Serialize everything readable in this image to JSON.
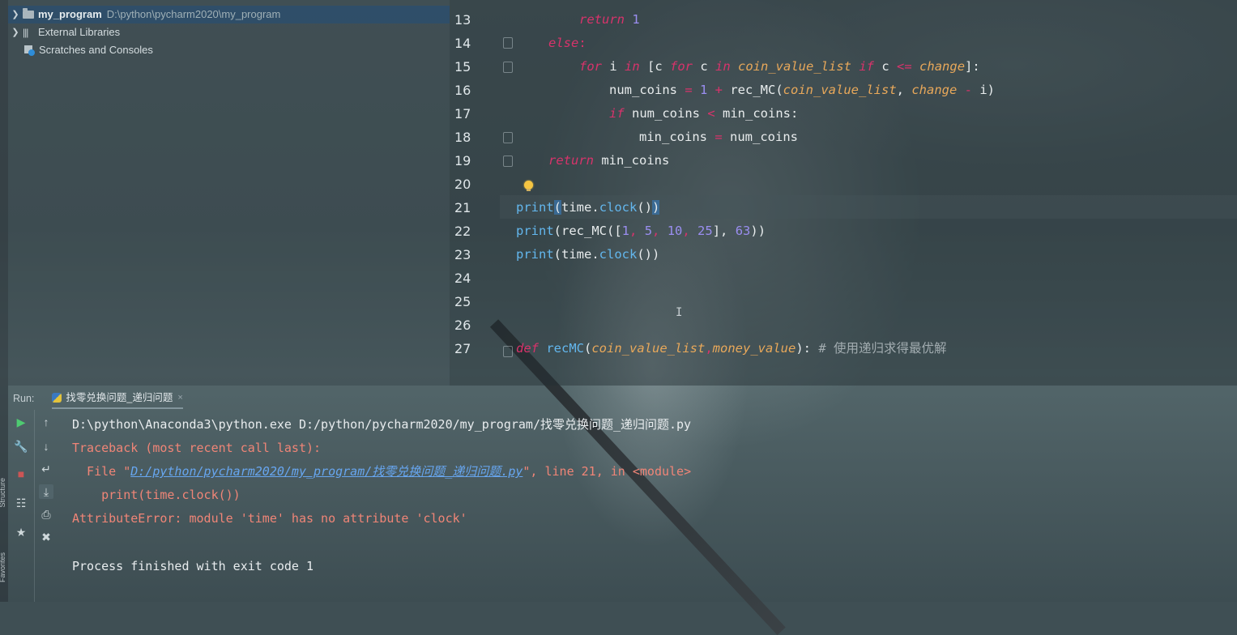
{
  "strip": {
    "structure_label": "Structure",
    "favorites_label": "Favorites"
  },
  "project_tree": [
    {
      "name": "my_program",
      "path": "D:\\python\\pycharm2020\\my_program",
      "selected": true
    },
    {
      "name": "External Libraries",
      "path": "",
      "selected": false
    },
    {
      "name": "Scratches and Consoles",
      "path": "",
      "selected": false
    }
  ],
  "editor": {
    "line_numbers": [
      "13",
      "14",
      "15",
      "16",
      "17",
      "18",
      "19",
      "20",
      "21",
      "22",
      "23",
      "24",
      "25",
      "26",
      "27"
    ],
    "current_line": "21",
    "code": {
      "l13": {
        "kw": "return",
        "num": "1"
      },
      "l14": {
        "kw": "else",
        "colon": ":"
      },
      "l15": {
        "kw_for": "for",
        "var_i": " i ",
        "kw_in": "in",
        "open": " [c ",
        "kw_for2": "for",
        "var_c": " c ",
        "kw_in2": "in",
        "par1": "coin_value_list",
        "kw_if": "if",
        "var_c2": " c ",
        "op": "<=",
        "par2": "change",
        "close": "]:"
      },
      "l16": {
        "pre": "num_coins ",
        "op1": "=",
        "num": " 1 ",
        "op2": "+",
        "fn": " rec_MC(",
        "par1": "coin_value_list",
        "comma": ", ",
        "par2": "change",
        "op3": " - ",
        "tail": "i)"
      },
      "l17": {
        "kw": "if",
        "mid": " num_coins ",
        "op": "<",
        "tail": " min_coins:"
      },
      "l18": {
        "pre": "min_coins ",
        "op": "=",
        "tail": " num_coins"
      },
      "l19": {
        "kw": "return",
        "tail": " min_coins"
      },
      "l21": {
        "fn": "print",
        "open": "(",
        "mid": "time.",
        "fn2": "clock",
        "tail": "()",
        "close": ")"
      },
      "l22": {
        "fn": "print",
        "mid": "(rec_MC([",
        "n1": "1",
        "c1": ", ",
        "n2": "5",
        "c2": ", ",
        "n3": "10",
        "c3": ", ",
        "n4": "25",
        "mid2": "], ",
        "n5": "63",
        "tail": "))"
      },
      "l23": {
        "fn": "print",
        "mid": "(time.",
        "fn2": "clock",
        "tail": "())"
      },
      "l27": {
        "kw": "def",
        "fn": " recMC",
        "open": "(",
        "par1": "coin_value_list",
        "comma": ",",
        "par2": "money_value",
        "close": "): ",
        "comment": "# 使用递归求得最优解"
      }
    }
  },
  "run_panel": {
    "label": "Run:",
    "tab_name": "找零兑换问题_递归问题",
    "tab_close": "×",
    "console": {
      "command": "D:\\python\\Anaconda3\\python.exe D:/python/pycharm2020/my_program/找零兑换问题_递归问题.py",
      "traceback": "Traceback (most recent call last):",
      "file_prefix": "  File \"",
      "file_link": "D:/python/pycharm2020/my_program/找零兑换问题_递归问题.py",
      "file_suffix": "\", line 21, in <module>",
      "code_line": "    print(time.clock())",
      "error": "AttributeError: module 'time' has no attribute 'clock'",
      "exit": "Process finished with exit code 1"
    }
  },
  "colors": {
    "keyword": "#d8336b",
    "function": "#63b7ee",
    "number": "#9a8ef0",
    "param": "#e8a85a",
    "error": "#f08577",
    "link": "#67a6f0",
    "run_green": "#4ecb71"
  }
}
